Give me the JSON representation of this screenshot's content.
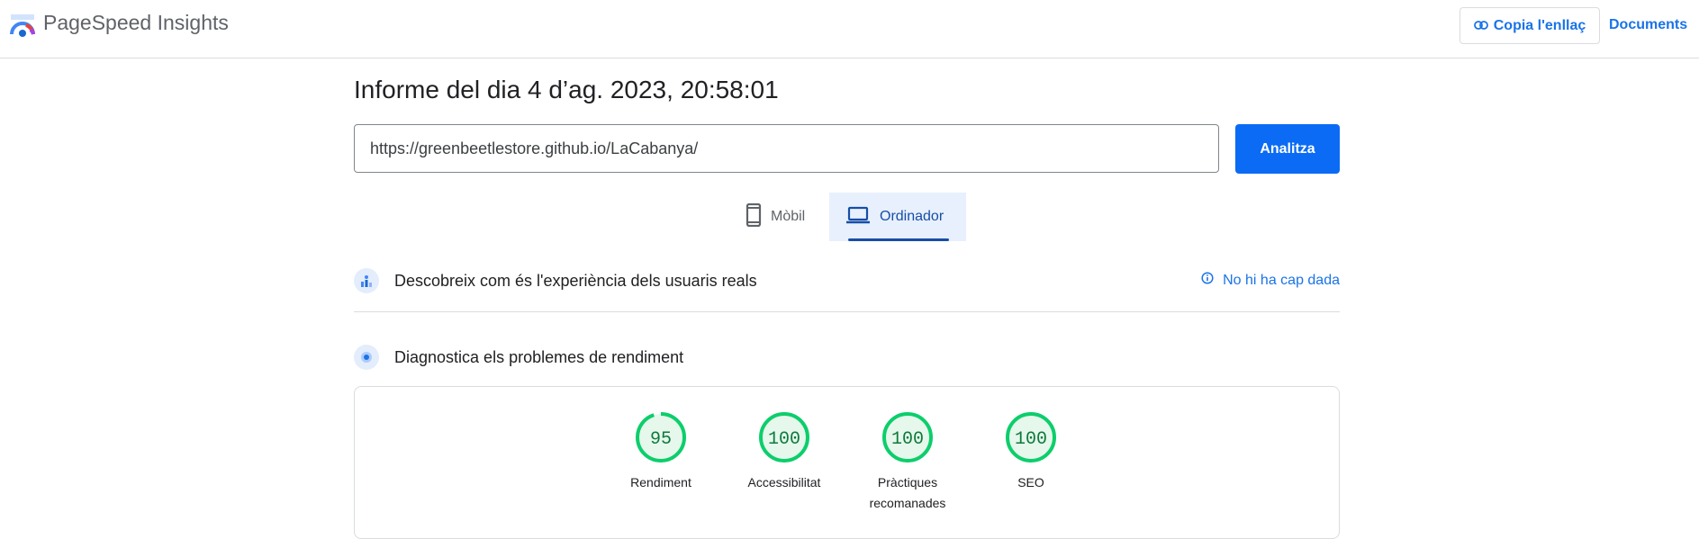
{
  "header": {
    "app_title": "PageSpeed Insights",
    "copy_link_label": "Copia l'enllaç",
    "docs_label": "Documents"
  },
  "report": {
    "title": "Informe del dia 4 d’ag. 2023, 20:58:01"
  },
  "search": {
    "url_value": "https://greenbeetlestore.github.io/LaCabanya/",
    "analyze_label": "Analitza"
  },
  "device_tabs": [
    {
      "label": "Mòbil",
      "icon": "phone-icon",
      "selected": false
    },
    {
      "label": "Ordinador",
      "icon": "laptop-icon",
      "selected": true
    }
  ],
  "field_data": {
    "label": "Descobreix com és l'experiència dels usuaris reals",
    "status": "No hi ha cap dada",
    "icon": "field-data-icon",
    "status_icon": "info-icon"
  },
  "diagnostics": {
    "label": "Diagnostica els problemes de rendiment",
    "icon": "lab-data-icon"
  },
  "scores": [
    {
      "value": "95",
      "score": 95,
      "label": "Rendiment"
    },
    {
      "value": "100",
      "score": 100,
      "label": "Accessibilitat"
    },
    {
      "value": "100",
      "score": 100,
      "label": "Pràctiques recomanades"
    },
    {
      "value": "100",
      "score": 100,
      "label": "SEO"
    }
  ],
  "colors": {
    "accent": "#1a73e8",
    "analyze_button": "#0b6bf5",
    "score_good": "#0cce6b",
    "score_text": "#0c7a3b",
    "score_bg": "#e6f7ec"
  }
}
